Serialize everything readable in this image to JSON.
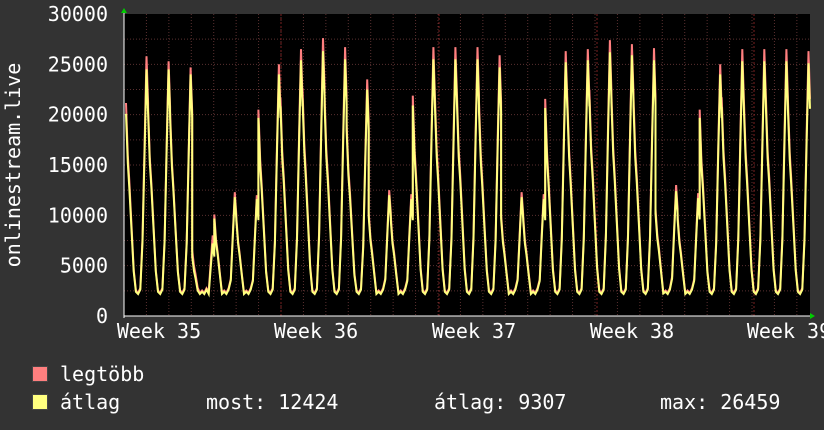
{
  "chart_data": {
    "type": "line",
    "ylabel": "onlinestream.live",
    "ylim": [
      0,
      30000
    ],
    "yticks": [
      0,
      5000,
      10000,
      15000,
      20000,
      25000,
      30000
    ],
    "xticks": [
      "Week 35",
      "Week 36",
      "Week 37",
      "Week 38",
      "Week 39"
    ],
    "grid": true,
    "series": [
      {
        "name": "legtöbb",
        "color": "#ff7f7f",
        "daily_peaks": [
          25800,
          25300,
          24700,
          8000,
          12300,
          12000,
          25000,
          26500,
          27600,
          26700,
          23500,
          12500,
          12100,
          26700,
          26700,
          26700,
          25900,
          12300,
          12100,
          26300,
          26500,
          27400,
          27000,
          26600,
          13000,
          12200,
          25000,
          26500,
          26500,
          26500,
          26300
        ]
      },
      {
        "name": "átlag",
        "color": "#ffff7f",
        "daily_peaks": [
          24500,
          24500,
          24000,
          7200,
          11800,
          11600,
          24000,
          25400,
          26300,
          25500,
          22500,
          12000,
          11600,
          25500,
          25500,
          25500,
          24700,
          11800,
          11600,
          25200,
          25400,
          26200,
          25900,
          25400,
          12400,
          11700,
          24000,
          25300,
          25300,
          25300,
          25100
        ]
      }
    ]
  },
  "legend": {
    "items": [
      {
        "label": "legtöbb",
        "color": "#ff7f7f"
      },
      {
        "label": "átlag",
        "color": "#ffff7f"
      }
    ]
  },
  "stats": {
    "most": "most: 12424",
    "atlag": "átlag: 9307",
    "max": "max: 26459"
  }
}
